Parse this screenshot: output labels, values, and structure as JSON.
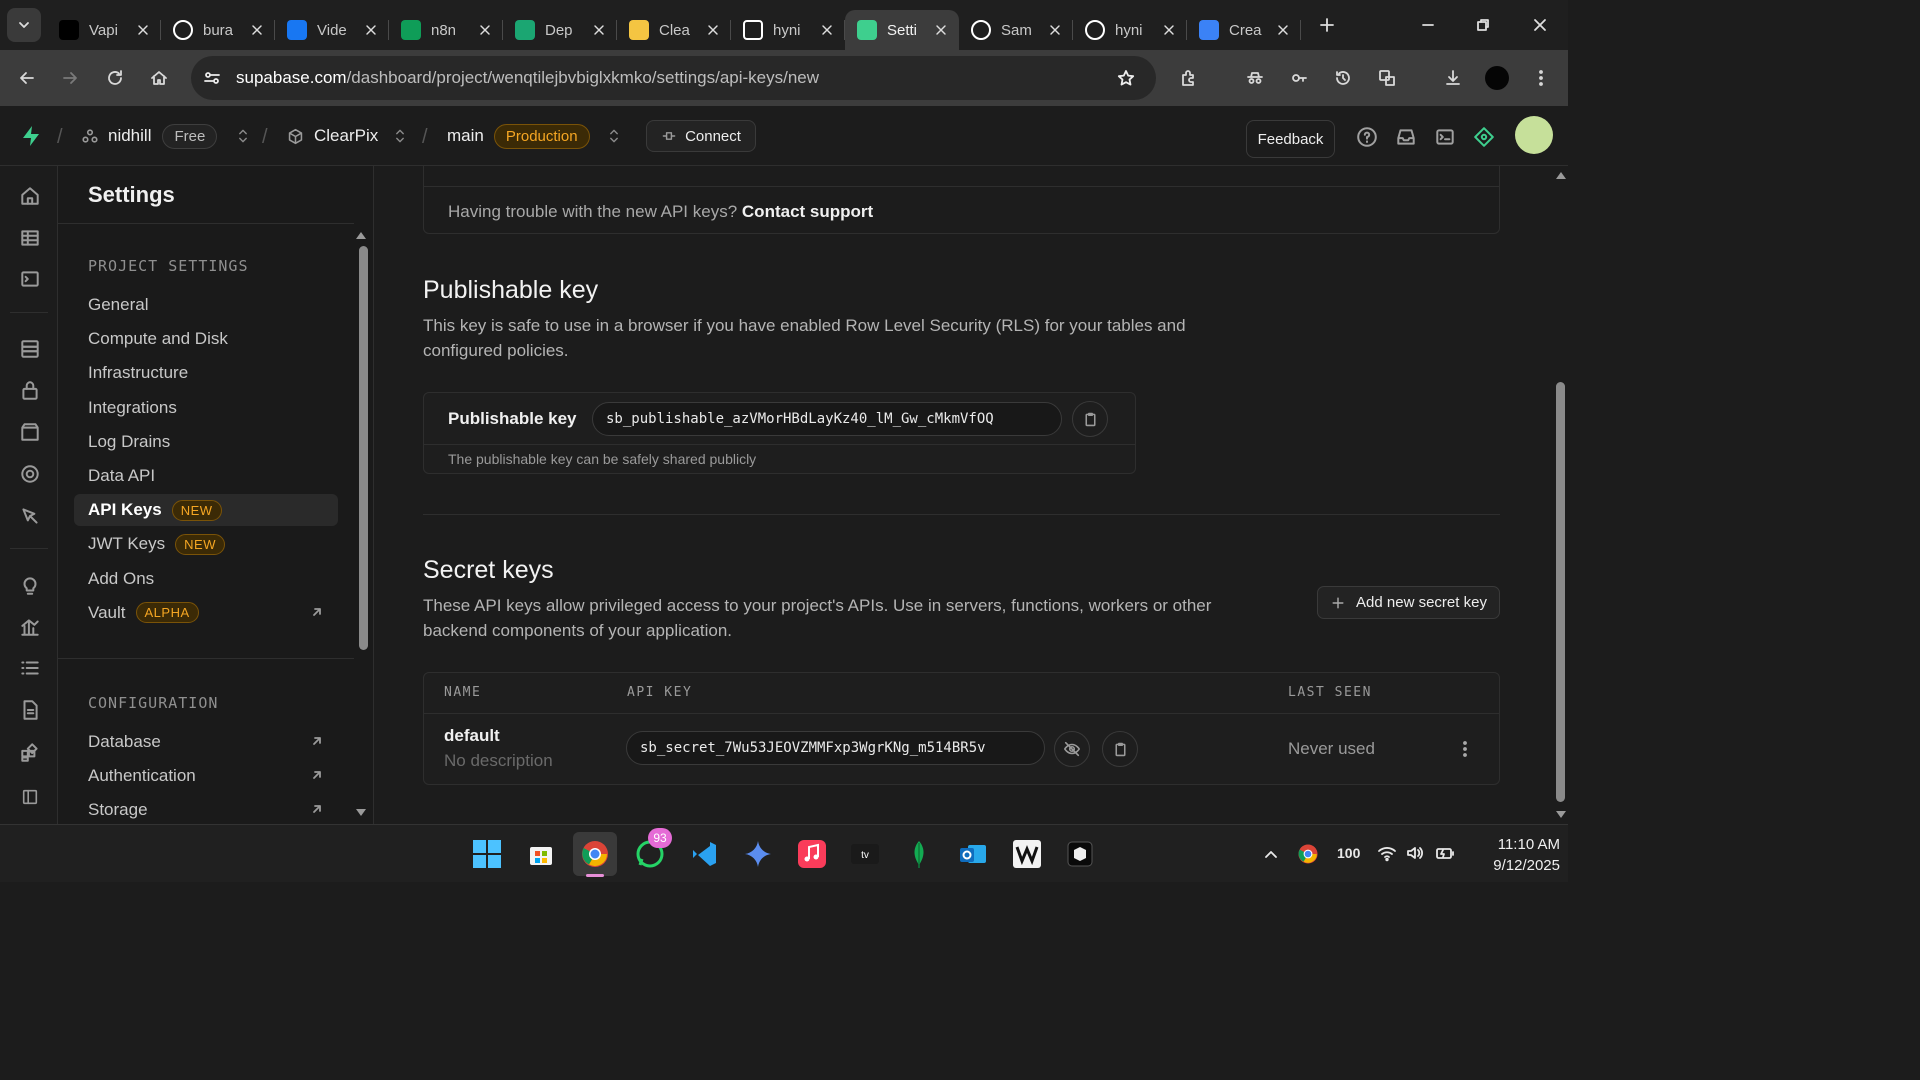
{
  "browser": {
    "tabs": [
      {
        "title": "Vapi",
        "favicon": "vapi-icon",
        "color": "#000000"
      },
      {
        "title": "bura",
        "favicon": "github-icon",
        "color": "#ffffff"
      },
      {
        "title": "Vide",
        "favicon": "bird-icon",
        "color": "#1877f2"
      },
      {
        "title": "n8n",
        "favicon": "sheets-plus-icon",
        "color": "#0f9d58"
      },
      {
        "title": "Dep",
        "favicon": "render-icon",
        "color": "#1ba672"
      },
      {
        "title": "Clea",
        "favicon": "bookmark-icon",
        "color": "#f4c542"
      },
      {
        "title": "hyni",
        "favicon": "b-icon",
        "color": "#ffffff"
      },
      {
        "title": "Setti",
        "favicon": "supabase-icon",
        "color": "#3ecf8e",
        "active": true
      },
      {
        "title": "Sam",
        "favicon": "openai-icon",
        "color": "#ffffff"
      },
      {
        "title": "hyni",
        "favicon": "github-icon",
        "color": "#ffffff"
      },
      {
        "title": "Crea",
        "favicon": "shield-icon",
        "color": "#3b82f6"
      }
    ],
    "url_host": "supabase.com",
    "url_path": "/dashboard/project/wenqtilejbvbiglxkmko/settings/api-keys/new"
  },
  "header": {
    "org_name": "nidhill",
    "org_plan": "Free",
    "project_name": "ClearPix",
    "branch": "main",
    "branch_env": "Production",
    "connect_label": "Connect",
    "feedback_label": "Feedback"
  },
  "settings": {
    "title": "Settings",
    "project_section": "PROJECT SETTINGS",
    "items": [
      {
        "label": "General"
      },
      {
        "label": "Compute and Disk"
      },
      {
        "label": "Infrastructure"
      },
      {
        "label": "Integrations"
      },
      {
        "label": "Log Drains"
      },
      {
        "label": "Data API"
      },
      {
        "label": "API Keys",
        "badge": "NEW",
        "active": true
      },
      {
        "label": "JWT Keys",
        "badge": "NEW"
      },
      {
        "label": "Add Ons"
      },
      {
        "label": "Vault",
        "badge": "ALPHA",
        "external": true
      }
    ],
    "config_section": "CONFIGURATION",
    "config_items": [
      {
        "label": "Database"
      },
      {
        "label": "Authentication"
      },
      {
        "label": "Storage"
      }
    ]
  },
  "main": {
    "support_text": "Having trouble with the new API keys?",
    "support_link": "Contact support",
    "publishable": {
      "heading": "Publishable key",
      "description": "This key is safe to use in a browser if you have enabled Row Level Security (RLS) for your tables and configured policies.",
      "label": "Publishable key",
      "value": "sb_publishable_azVMorHBdLayKz40_lM_Gw_cMkmVfOQ",
      "note": "The publishable key can be safely shared publicly"
    },
    "secret": {
      "heading": "Secret keys",
      "description": "These API keys allow privileged access to your project's APIs. Use in servers, functions, workers or other backend components of your application.",
      "add_button": "Add new secret key",
      "columns": [
        "NAME",
        "API KEY",
        "LAST SEEN"
      ],
      "rows": [
        {
          "name": "default",
          "description": "No description",
          "key": "sb_secret_7Wu53JEOVZMMFxp3WgrKNg_m514BR5v",
          "last_seen": "Never used"
        }
      ]
    }
  },
  "taskbar": {
    "whatsapp_badge": "93",
    "battery": "100",
    "time": "11:10 AM",
    "date": "9/12/2025"
  }
}
